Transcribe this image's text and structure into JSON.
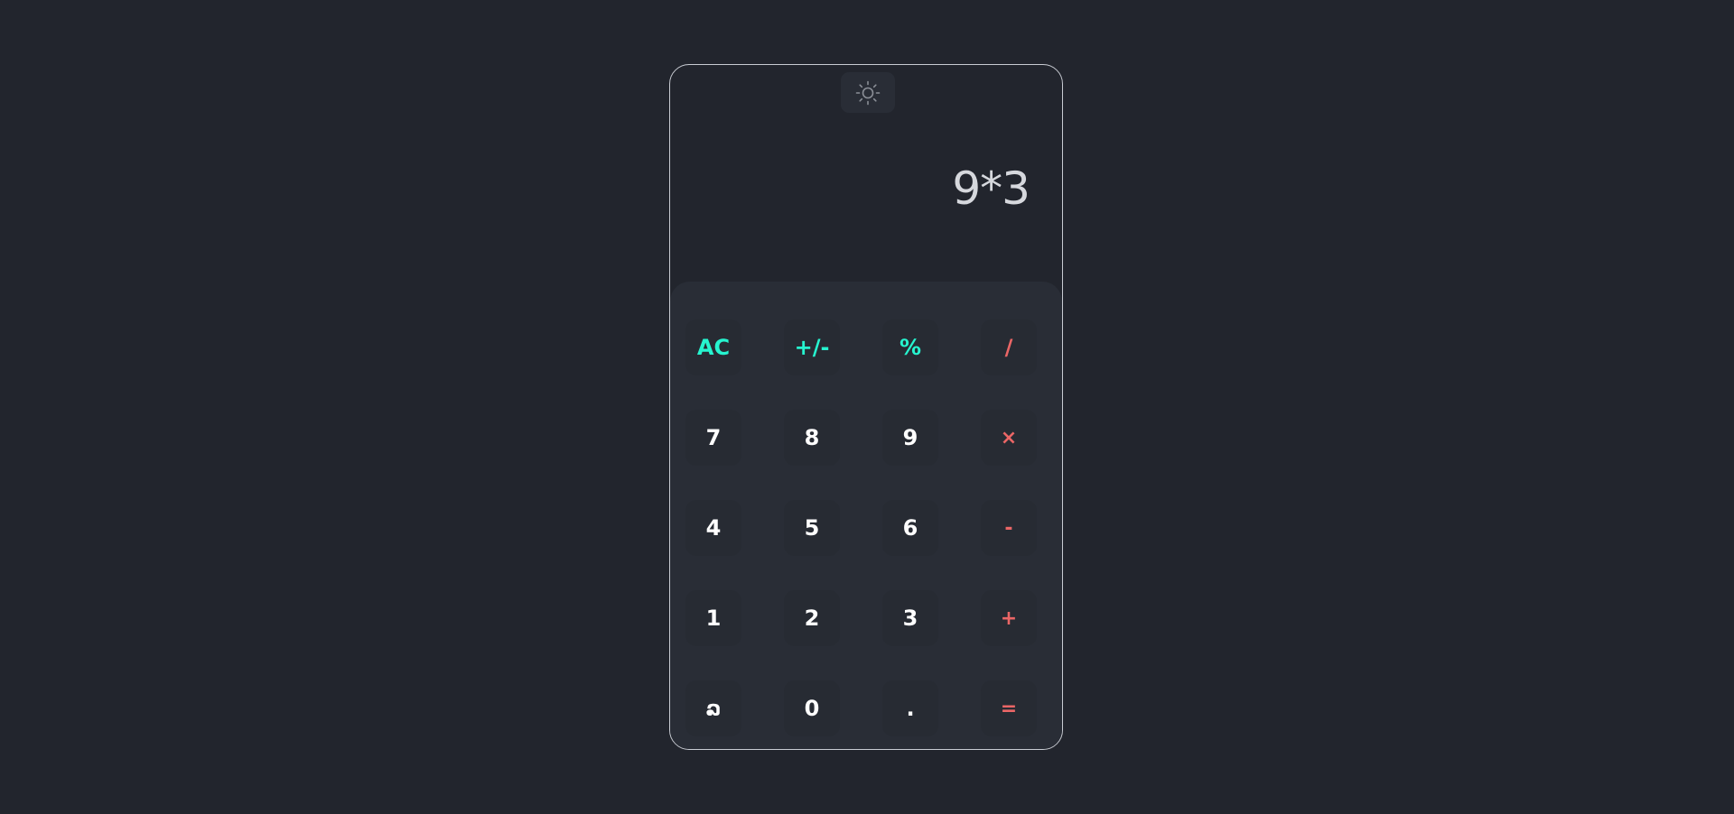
{
  "theme_toggle": {
    "icon": "sun-icon"
  },
  "display": {
    "expression": "9*3"
  },
  "colors": {
    "background": "#22252d",
    "keypad": "#292d36",
    "key": "#272b33",
    "accent_util": "#26f4cf",
    "accent_op": "#eb6666",
    "digit": "#ffffff",
    "display_text": "#d6d8dd"
  },
  "keys": {
    "ac": "AC",
    "sign": "+/-",
    "percent": "%",
    "divide": "/",
    "seven": "7",
    "eight": "8",
    "nine": "9",
    "multiply": "×",
    "four": "4",
    "five": "5",
    "six": "6",
    "subtract": "-",
    "one": "1",
    "two": "2",
    "three": "3",
    "add": "+",
    "undo": "ລ",
    "zero": "0",
    "decimal": ".",
    "equals": "="
  }
}
